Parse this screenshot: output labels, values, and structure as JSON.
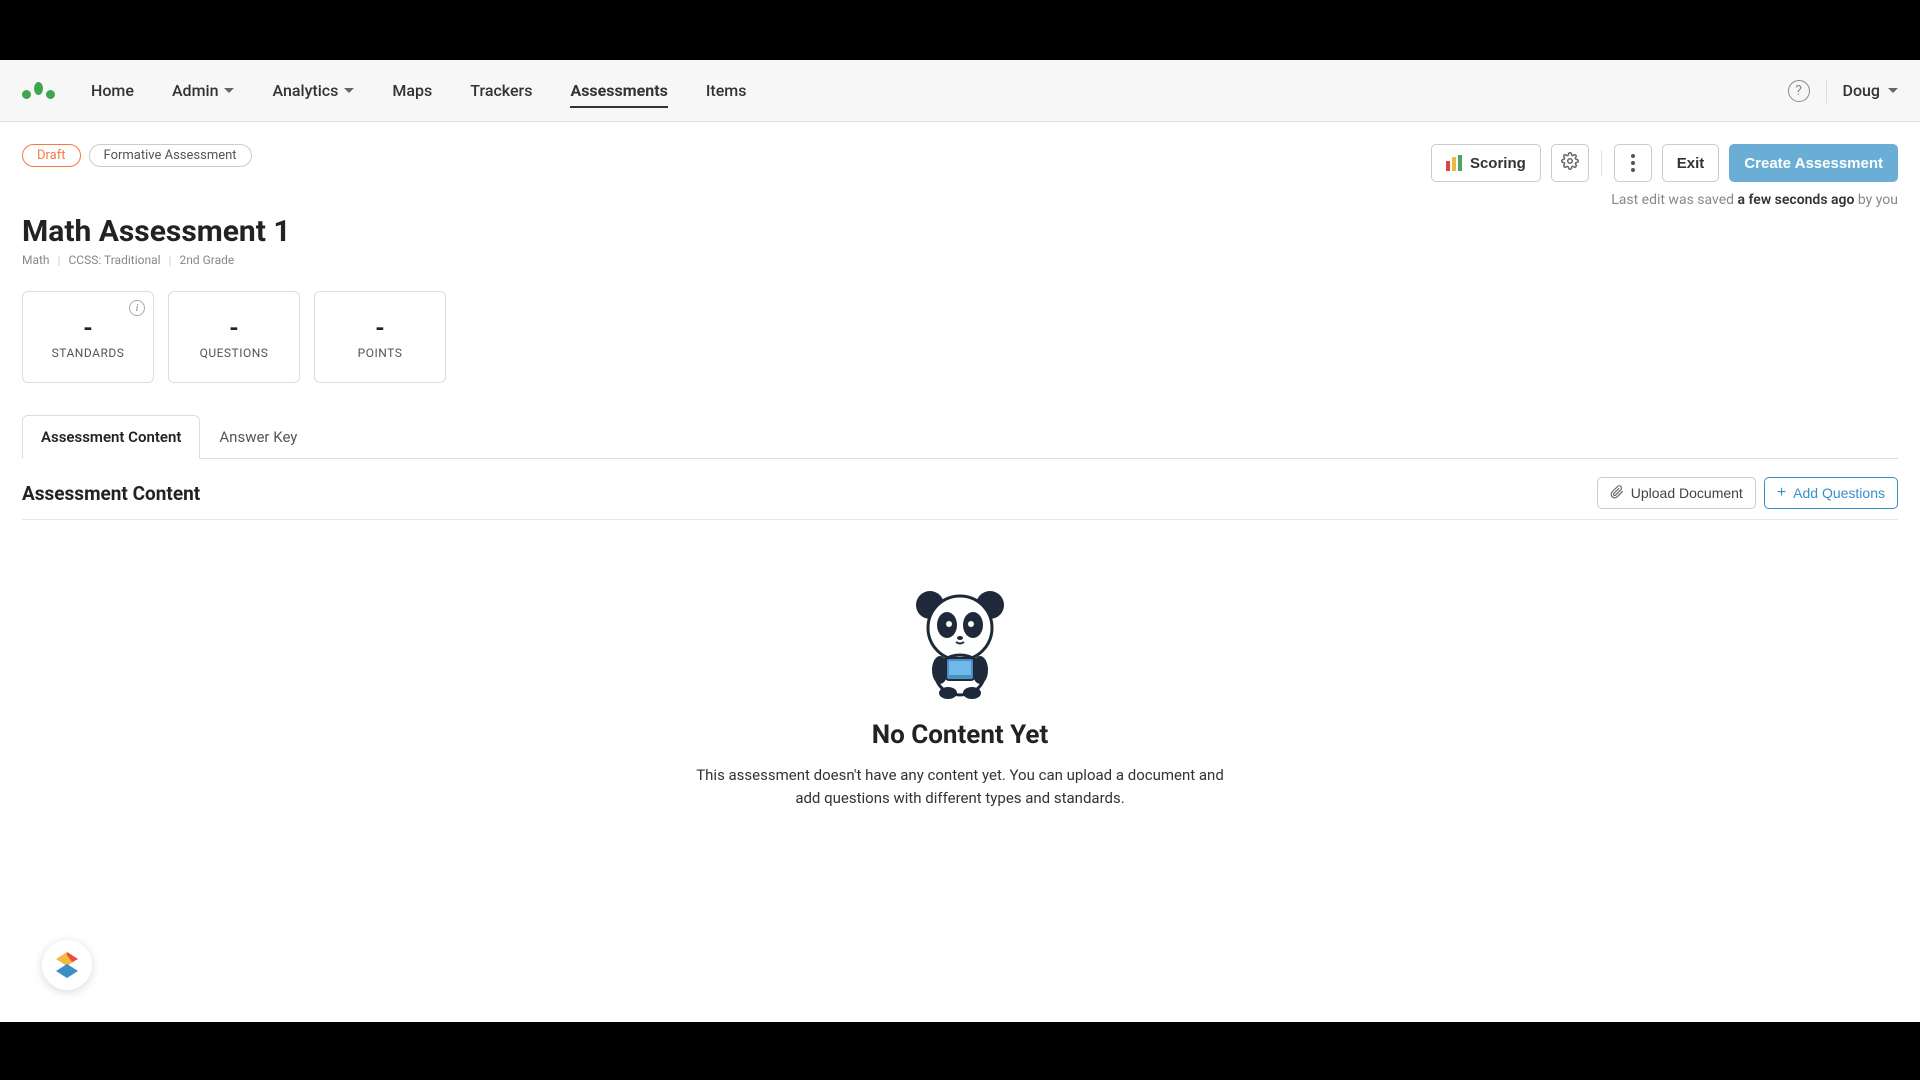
{
  "nav": {
    "items": [
      {
        "label": "Home",
        "dropdown": false
      },
      {
        "label": "Admin",
        "dropdown": true
      },
      {
        "label": "Analytics",
        "dropdown": true
      },
      {
        "label": "Maps",
        "dropdown": false
      },
      {
        "label": "Trackers",
        "dropdown": false
      },
      {
        "label": "Assessments",
        "dropdown": false,
        "active": true
      },
      {
        "label": "Items",
        "dropdown": false
      }
    ],
    "user": "Doug"
  },
  "badges": {
    "draft": "Draft",
    "type": "Formative Assessment"
  },
  "actions": {
    "scoring": "Scoring",
    "exit": "Exit",
    "create": "Create Assessment"
  },
  "saveStatus": {
    "prefix": "Last edit was saved ",
    "when": "a few seconds ago",
    "suffix": " by you"
  },
  "title": "Math Assessment 1",
  "breadcrumb": {
    "subject": "Math",
    "standard": "CCSS: Traditional",
    "grade": "2nd Grade"
  },
  "stats": [
    {
      "value": "-",
      "label": "STANDARDS",
      "info": true
    },
    {
      "value": "-",
      "label": "QUESTIONS"
    },
    {
      "value": "-",
      "label": "POINTS"
    }
  ],
  "tabs": {
    "content": "Assessment Content",
    "answerKey": "Answer Key"
  },
  "section": {
    "title": "Assessment Content",
    "upload": "Upload Document",
    "addQuestions": "Add Questions"
  },
  "empty": {
    "title": "No Content Yet",
    "text": "This assessment doesn't have any content yet. You can upload a document and add questions with different types and standards."
  }
}
